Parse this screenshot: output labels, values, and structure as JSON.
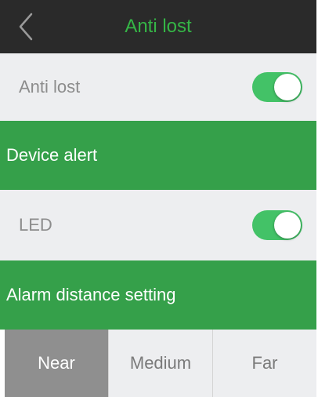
{
  "navbar": {
    "title": "Anti lost",
    "back_icon": "chevron-left-icon",
    "title_color": "#35b546"
  },
  "anti_lost": {
    "label": "Anti lost",
    "enabled": true
  },
  "device_alert": {
    "header": "Device alert"
  },
  "led": {
    "label": "LED",
    "enabled": true
  },
  "alarm_distance": {
    "header": "Alarm distance setting",
    "options": [
      "Near",
      "Medium",
      "Far"
    ],
    "selected": "Near"
  },
  "colors": {
    "accent_green": "#35a04a",
    "toggle_on": "#43c267",
    "navbar_bg": "#2a2a2a",
    "row_bg": "#edeef0",
    "selected_segment": "#8f8f8f"
  }
}
